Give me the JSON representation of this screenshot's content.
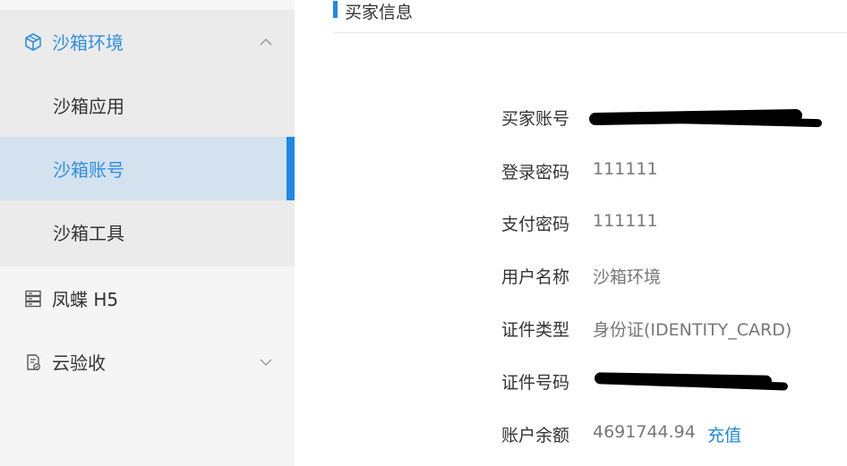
{
  "sidebar": {
    "sandbox": {
      "label": "沙箱环境",
      "icon": "cube-icon",
      "chevron": "chevron-up-icon"
    },
    "sub_items": [
      {
        "label": "沙箱应用"
      },
      {
        "label": "沙箱账号",
        "active": true
      },
      {
        "label": "沙箱工具"
      }
    ],
    "fengdie": {
      "label": "凤蝶 H5",
      "icon": "server-icon"
    },
    "yunyanshou": {
      "label": "云验收",
      "icon": "clipboard-icon",
      "chevron": "chevron-down-icon"
    }
  },
  "main": {
    "section_title": "买家信息",
    "fields": [
      {
        "key": "买家账号",
        "value": ""
      },
      {
        "key": "登录密码",
        "value": "111111"
      },
      {
        "key": "支付密码",
        "value": "111111"
      },
      {
        "key": "用户名称",
        "value": "沙箱环境"
      },
      {
        "key": "证件类型",
        "value": "身份证(IDENTITY_CARD)"
      },
      {
        "key": "证件号码",
        "value": ""
      },
      {
        "key": "账户余额",
        "value": "4691744.94",
        "action": "充值"
      }
    ]
  },
  "colors": {
    "accent": "#1e88e5",
    "active_text": "#2f8fe0",
    "active_bg": "#d3e2ee",
    "sidebar_bg": "#f5f5f5",
    "submenu_bg": "#ebebeb"
  }
}
